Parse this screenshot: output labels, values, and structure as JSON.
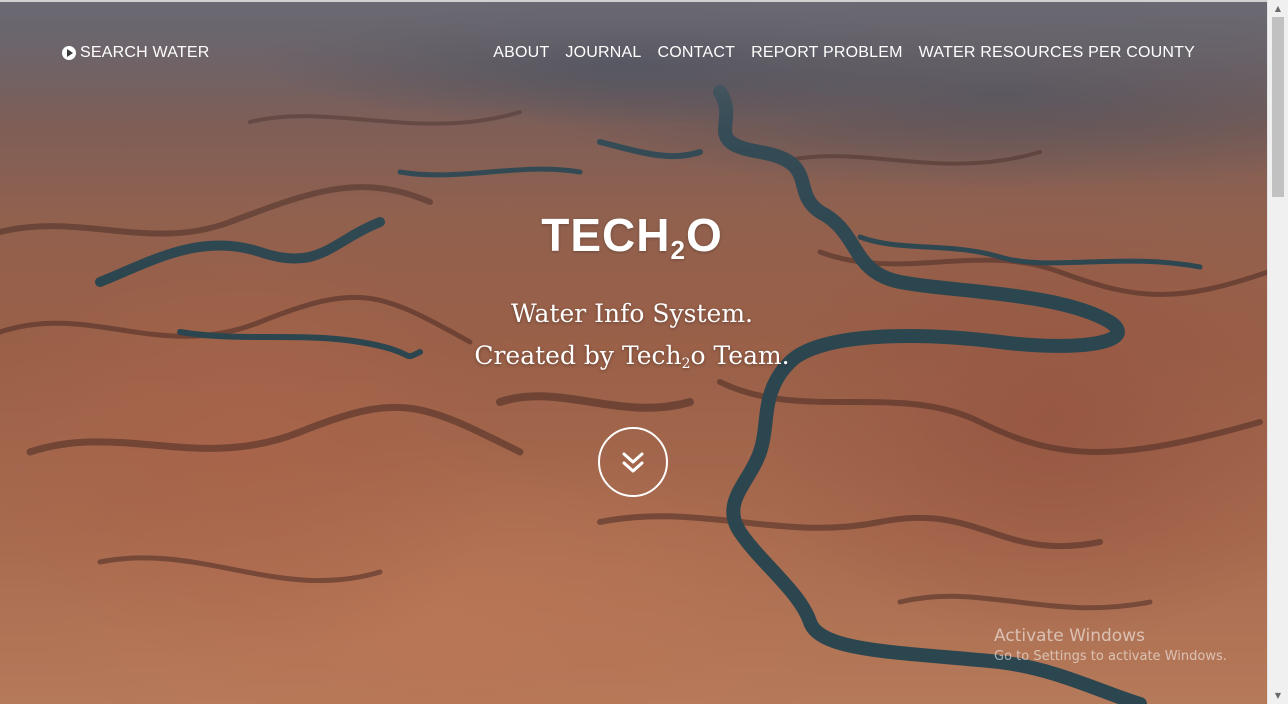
{
  "nav": {
    "brand_label": "SEARCH WATER",
    "brand_icon": "play-circle-icon",
    "links": [
      {
        "label": "ABOUT"
      },
      {
        "label": "JOURNAL"
      },
      {
        "label": "CONTACT"
      },
      {
        "label": "REPORT PROBLEM"
      },
      {
        "label": "WATER RESOURCES PER COUNTY"
      }
    ]
  },
  "hero": {
    "title_main": "TECH",
    "title_sub": "2",
    "title_end": "O",
    "tagline_line1": "Water Info System.",
    "tagline_line2_pre": "Created by Tech",
    "tagline_line2_sub": "2",
    "tagline_line2_post": "o Team.",
    "scroll_icon": "double-chevron-down-icon"
  },
  "watermark": {
    "title": "Activate Windows",
    "subtitle": "Go to Settings to activate Windows."
  },
  "colors": {
    "text": "#ffffff",
    "terrain_base": "#9a6048",
    "water": "#2c4650"
  }
}
